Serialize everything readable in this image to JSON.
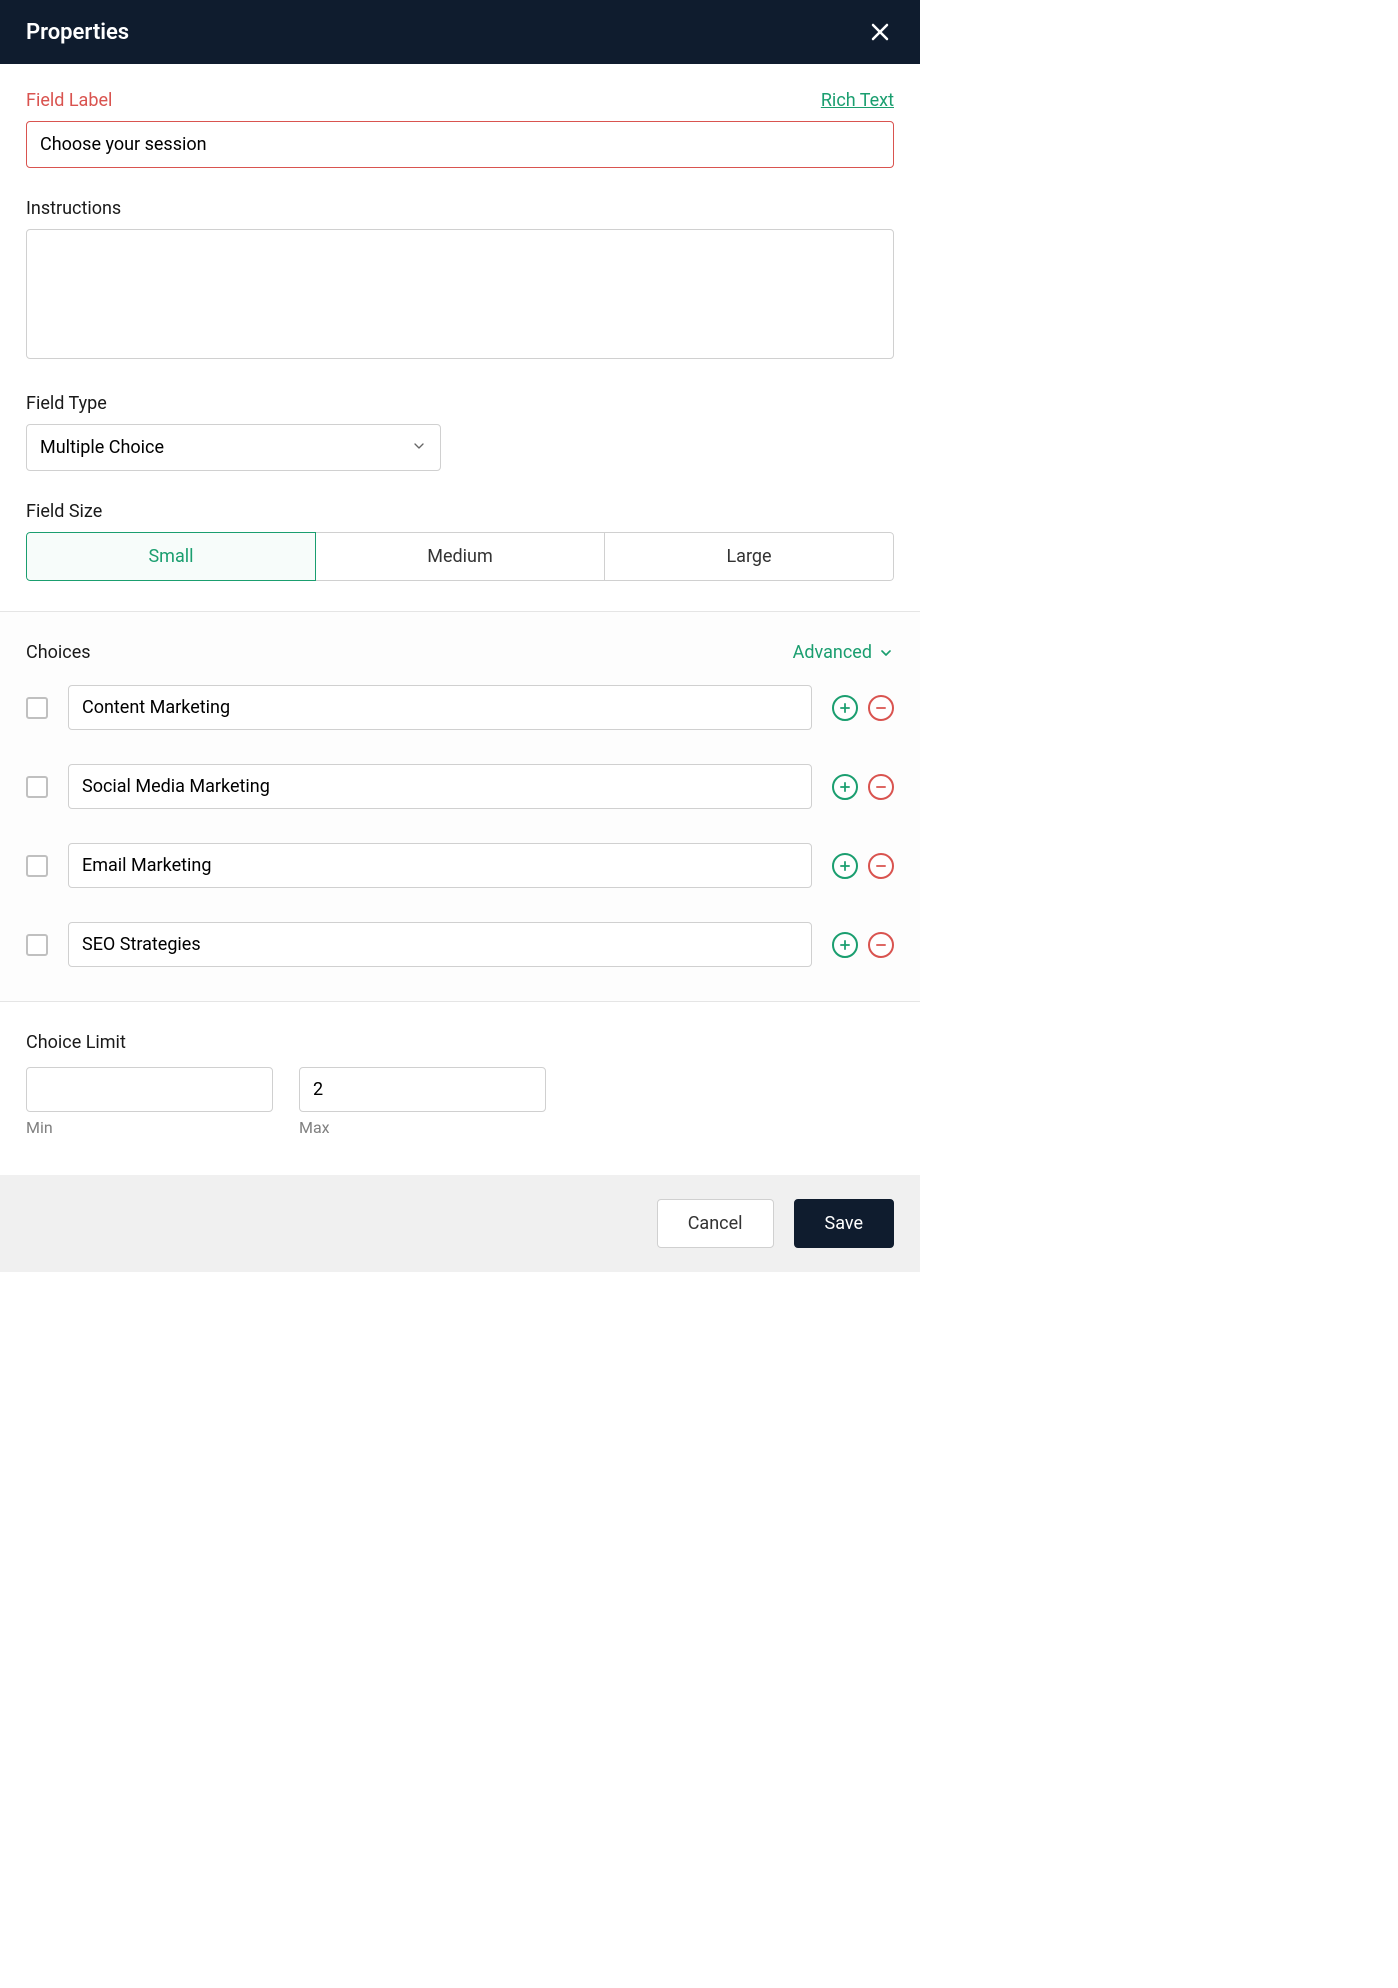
{
  "header": {
    "title": "Properties"
  },
  "field_label": {
    "label": "Field Label",
    "rich_text": "Rich Text",
    "value": "Choose your session"
  },
  "instructions": {
    "label": "Instructions",
    "value": ""
  },
  "field_type": {
    "label": "Field Type",
    "value": "Multiple Choice"
  },
  "field_size": {
    "label": "Field Size",
    "options": [
      "Small",
      "Medium",
      "Large"
    ],
    "selected": "Small"
  },
  "choices": {
    "label": "Choices",
    "advanced": "Advanced",
    "items": [
      {
        "value": "Content Marketing",
        "checked": false
      },
      {
        "value": "Social Media Marketing",
        "checked": false
      },
      {
        "value": "Email Marketing",
        "checked": false
      },
      {
        "value": "SEO Strategies",
        "checked": false
      }
    ]
  },
  "choice_limit": {
    "label": "Choice Limit",
    "min_label": "Min",
    "max_label": "Max",
    "min_value": "",
    "max_value": "2"
  },
  "footer": {
    "cancel": "Cancel",
    "save": "Save"
  }
}
